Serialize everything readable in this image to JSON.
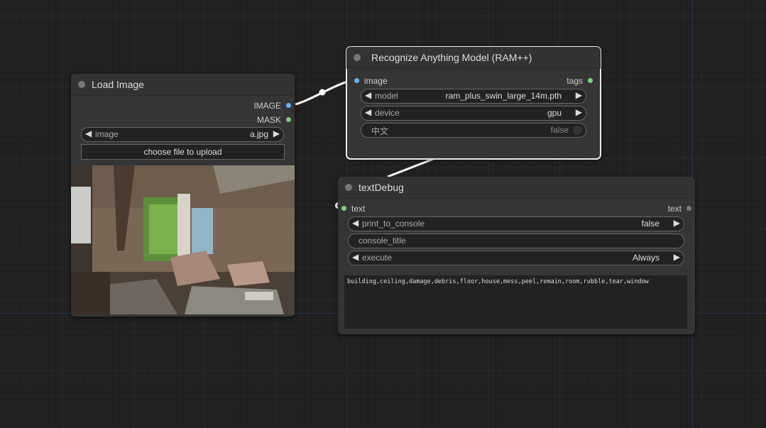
{
  "nodes": {
    "load_image": {
      "title": "Load Image",
      "outputs": [
        "IMAGE",
        "MASK"
      ],
      "image_widget": {
        "label": "image",
        "value": "a.jpg"
      },
      "upload_button": "choose file to upload"
    },
    "ram": {
      "title": "Recognize Anything Model (RAM++)",
      "input": "image",
      "output": "tags",
      "model_widget": {
        "label": "model",
        "value": "ram_plus_swin_large_14m.pth"
      },
      "device_widget": {
        "label": "device",
        "value": "gpu"
      },
      "chinese_widget": {
        "label": "中文",
        "value": "false"
      }
    },
    "text_debug": {
      "title": "textDebug",
      "input": "text",
      "output": "text",
      "print_widget": {
        "label": "print_to_console",
        "value": "false"
      },
      "console_title": "console_title",
      "execute_widget": {
        "label": "execute",
        "value": "Always"
      },
      "output_text": "building,ceiling,damage,debris,floor,house,mess,peel,remain,room,rubble,tear,window"
    }
  },
  "colors": {
    "image_slot": "#64b5f6",
    "mask_slot": "#81c784",
    "string_slot": "#7ed67e",
    "canvas": "#222222"
  },
  "icons": {
    "left_arrow": "◀",
    "right_arrow": "▶"
  }
}
